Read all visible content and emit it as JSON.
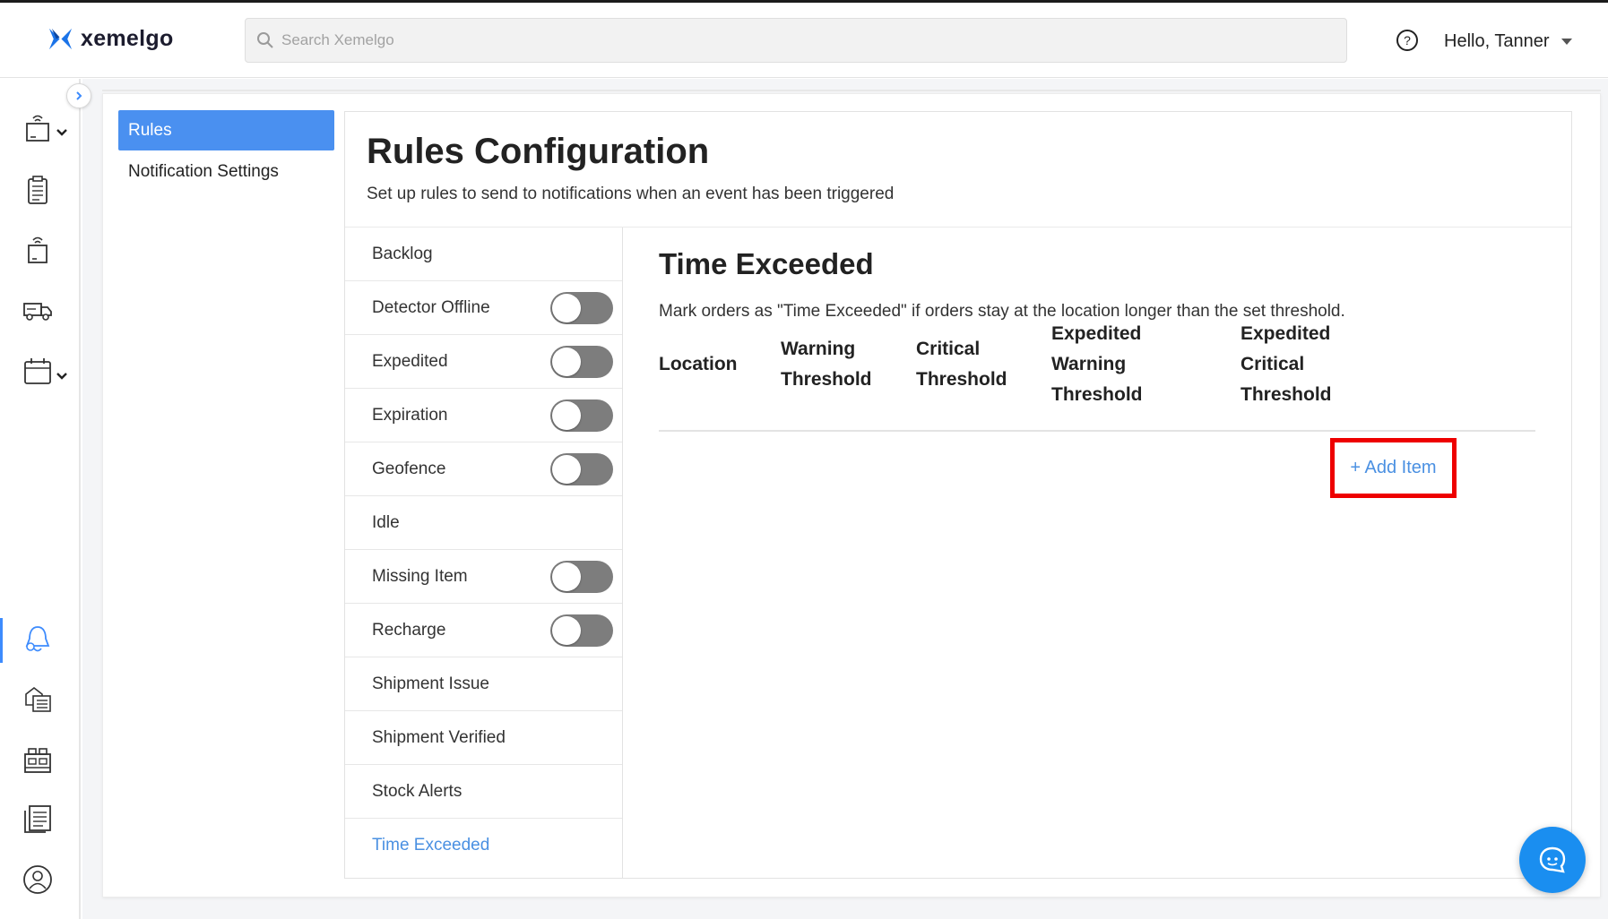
{
  "app": {
    "logo_text": "xemelgo",
    "brand_color": "#1a73e8"
  },
  "header": {
    "search_placeholder": "Search Xemelgo",
    "user_greeting": "Hello, Tanner"
  },
  "leftnav": {
    "icons": [
      "rfid-item-icon",
      "clipboard-icon",
      "rfid-tag-icon",
      "truck-icon",
      "calendar-icon",
      "bell-settings-icon",
      "inventory-list-icon",
      "warehouse-icon",
      "report-icon",
      "user-circle-icon"
    ],
    "active_index": 5
  },
  "subnav": {
    "items": [
      {
        "label": "Rules",
        "active": true
      },
      {
        "label": "Notification Settings",
        "active": false
      }
    ]
  },
  "rules": {
    "title": "Rules Configuration",
    "subtitle": "Set up rules to send to notifications when an event has been triggered",
    "items": [
      {
        "label": "Backlog",
        "toggle": false,
        "enabled": false
      },
      {
        "label": "Detector Offline",
        "toggle": true,
        "enabled": false
      },
      {
        "label": "Expedited",
        "toggle": true,
        "enabled": false
      },
      {
        "label": "Expiration",
        "toggle": true,
        "enabled": false
      },
      {
        "label": "Geofence",
        "toggle": true,
        "enabled": false
      },
      {
        "label": "Idle",
        "toggle": false,
        "enabled": false
      },
      {
        "label": "Missing Item",
        "toggle": true,
        "enabled": false
      },
      {
        "label": "Recharge",
        "toggle": true,
        "enabled": false
      },
      {
        "label": "Shipment Issue",
        "toggle": false,
        "enabled": false
      },
      {
        "label": "Shipment Verified",
        "toggle": false,
        "enabled": false
      },
      {
        "label": "Stock Alerts",
        "toggle": false,
        "enabled": false
      },
      {
        "label": "Time Exceeded",
        "toggle": false,
        "enabled": false,
        "selected": true
      }
    ]
  },
  "detail": {
    "title": "Time Exceeded",
    "description": "Mark orders as \"Time Exceeded\" if orders stay at the location longer than the set threshold.",
    "columns": [
      {
        "line1": "Location",
        "line2": "",
        "line3": ""
      },
      {
        "line1": "Warning",
        "line2": "Threshold",
        "line3": ""
      },
      {
        "line1": "Critical",
        "line2": "Threshold",
        "line3": ""
      },
      {
        "line1": "Expedited",
        "line2": "Warning",
        "line3": "Threshold"
      },
      {
        "line1": "Expedited",
        "line2": "Critical",
        "line3": "Threshold"
      }
    ],
    "add_item_label": "+ Add Item"
  },
  "colors": {
    "accent": "#4a90e2",
    "active_tab": "#4a90f0",
    "highlight_box": "#ee0000",
    "toggle_off": "#7d7d7d",
    "chat_button": "#1a8ef0"
  }
}
